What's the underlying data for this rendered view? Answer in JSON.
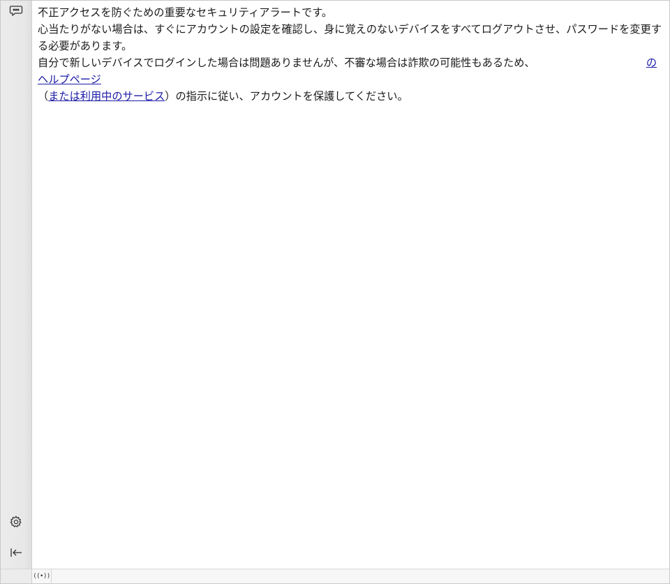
{
  "sidebar": {
    "top_icon": "chat-bubble-icon",
    "gear_icon": "gear-icon",
    "collapse_icon": "collapse-left-icon"
  },
  "message": {
    "line1": "不正アクセスを防ぐための重要なセキュリティアラートです。",
    "line2": "心当たりがない場合は、すぐにアカウントの設定を確認し、身に覚えのないデバイスをすべてログアウトさせ、パスワードを変更する必要があります。",
    "line3_text": "自分で新しいデバイスでログインした場合は問題ありませんが、不審な場合は詐欺の可能性もあるため、",
    "line3_link": "のヘルプページ",
    "line3_link_part1": "の",
    "line3_link_part2": "ヘルプページ",
    "line4_open": "（",
    "line4_link": "または利用中のサービス",
    "line4_rest": "）の指示に従い、アカウントを保護してください。"
  },
  "statusbar": {
    "broadcast_icon": "broadcast-icon",
    "broadcast_glyph": "((•))"
  },
  "colors": {
    "link": "#1a1aa6",
    "text": "#1a1a1a",
    "sidebar_bg": "#e7e7e7"
  }
}
